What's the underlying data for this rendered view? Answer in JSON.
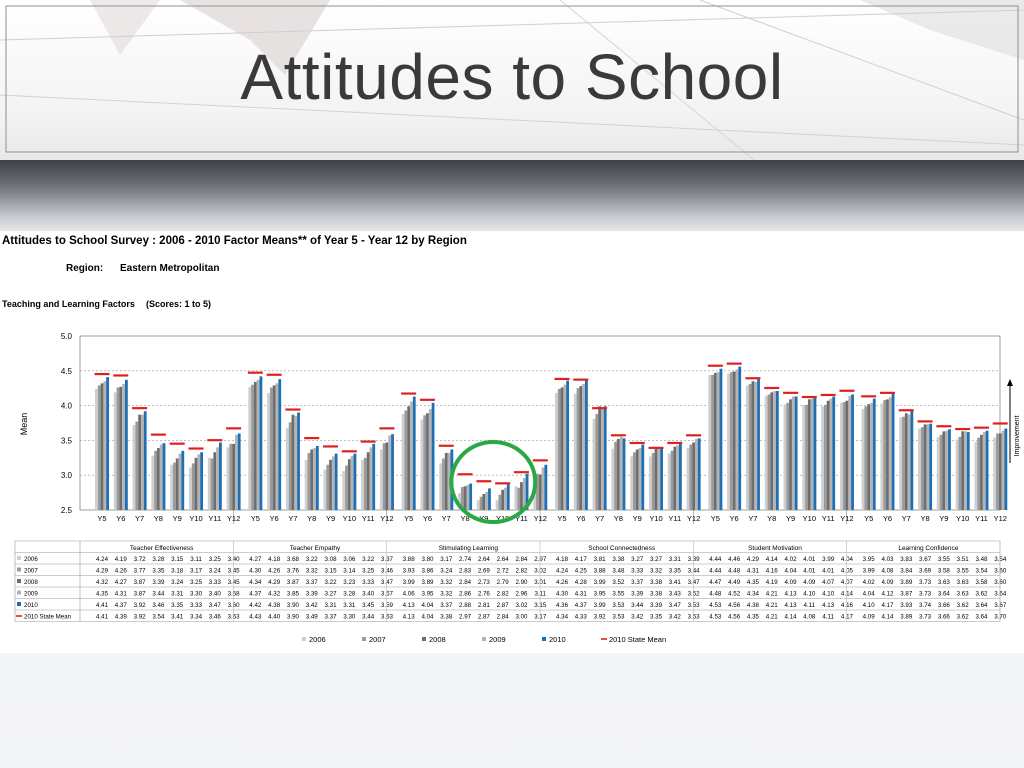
{
  "slide": {
    "title": "Attitudes to School"
  },
  "report": {
    "heading": "Attitudes to School Survey : 2006 - 2010 Factor Means** of Year 5 - Year 12 by Region",
    "region_label": "Region:",
    "region_value": "Eastern Metropolitan",
    "section_label": "Teaching and Learning Factors",
    "scores_label": "(Scores: 1 to 5)",
    "improvement_label": "Improvement"
  },
  "colors": {
    "2006": "#cfcfcf",
    "2007": "#9a9a9a",
    "2008": "#6e6e6e",
    "2009": "#b4b4b4",
    "2010": "#1f6fb5",
    "state": "#e02020",
    "highlight": "#2aa845"
  },
  "chart_data": {
    "type": "bar",
    "ylabel": "Mean",
    "ylim": [
      2.5,
      5.0
    ],
    "yticks": [
      2.5,
      3.0,
      3.5,
      4.0,
      4.5,
      5.0
    ],
    "grid": true,
    "legend_position": "bottom",
    "year_levels": [
      "Y5",
      "Y6",
      "Y7",
      "Y8",
      "Y9",
      "Y10",
      "Y11",
      "Y12"
    ],
    "factors": [
      {
        "name": "Teacher Effectiveness",
        "series": [
          {
            "name": "2006",
            "values": [
              "4.24",
              "4.19",
              "3.72",
              "3.28",
              "3.15",
              "3.11",
              "3.25",
              "3.40"
            ]
          },
          {
            "name": "2007",
            "values": [
              "4.29",
              "4.26",
              "3.77",
              "3.35",
              "3.18",
              "3.17",
              "3.24",
              "3.45"
            ]
          },
          {
            "name": "2008",
            "values": [
              "4.32",
              "4.27",
              "3.87",
              "3.39",
              "3.24",
              "3.25",
              "3.33",
              "3.45"
            ]
          },
          {
            "name": "2009",
            "values": [
              "4.35",
              "4.31",
              "3.87",
              "3.44",
              "3.31",
              "3.30",
              "3.40",
              "3.58"
            ]
          },
          {
            "name": "2010",
            "values": [
              "4.41",
              "4.37",
              "3.92",
              "3.46",
              "3.35",
              "3.33",
              "3.47",
              "3.60"
            ]
          },
          {
            "name": "2010 State Mean",
            "values": [
              "4.41",
              "4.39",
              "3.92",
              "3.54",
              "3.41",
              "3.34",
              "3.46",
              "3.63"
            ]
          }
        ]
      },
      {
        "name": "Teacher Empathy",
        "series": [
          {
            "name": "2006",
            "values": [
              "4.27",
              "4.18",
              "3.68",
              "3.22",
              "3.08",
              "3.06",
              "3.22",
              "3.37"
            ]
          },
          {
            "name": "2007",
            "values": [
              "4.30",
              "4.26",
              "3.76",
              "3.32",
              "3.15",
              "3.14",
              "3.25",
              "3.46"
            ]
          },
          {
            "name": "2008",
            "values": [
              "4.34",
              "4.29",
              "3.87",
              "3.37",
              "3.22",
              "3.23",
              "3.33",
              "3.47"
            ]
          },
          {
            "name": "2009",
            "values": [
              "4.37",
              "4.32",
              "3.85",
              "3.39",
              "3.27",
              "3.28",
              "3.40",
              "3.57"
            ]
          },
          {
            "name": "2010",
            "values": [
              "4.42",
              "4.38",
              "3.90",
              "3.42",
              "3.31",
              "3.31",
              "3.45",
              "3.59"
            ]
          },
          {
            "name": "2010 State Mean",
            "values": [
              "4.43",
              "4.40",
              "3.90",
              "3.49",
              "3.37",
              "3.30",
              "3.44",
              "3.63"
            ]
          }
        ]
      },
      {
        "name": "Stimulating Learning",
        "series": [
          {
            "name": "2006",
            "values": [
              "3.88",
              "3.80",
              "3.17",
              "2.74",
              "2.64",
              "2.64",
              "2.84",
              "2.97"
            ]
          },
          {
            "name": "2007",
            "values": [
              "3.93",
              "3.86",
              "3.24",
              "2.83",
              "2.69",
              "2.72",
              "2.82",
              "3.02"
            ]
          },
          {
            "name": "2008",
            "values": [
              "3.99",
              "3.89",
              "3.32",
              "2.84",
              "2.73",
              "2.79",
              "2.90",
              "3.01"
            ]
          },
          {
            "name": "2009",
            "values": [
              "4.06",
              "3.95",
              "3.32",
              "2.86",
              "2.76",
              "2.82",
              "2.96",
              "3.11"
            ]
          },
          {
            "name": "2010",
            "values": [
              "4.13",
              "4.04",
              "3.37",
              "2.88",
              "2.81",
              "2.87",
              "3.02",
              "3.15"
            ]
          },
          {
            "name": "2010 State Mean",
            "values": [
              "4.13",
              "4.04",
              "3.38",
              "2.97",
              "2.87",
              "2.84",
              "3.00",
              "3.17"
            ]
          }
        ]
      },
      {
        "name": "School Connectedness",
        "series": [
          {
            "name": "2006",
            "values": [
              "4.18",
              "4.17",
              "3.81",
              "3.38",
              "3.27",
              "3.27",
              "3.31",
              "3.39"
            ]
          },
          {
            "name": "2007",
            "values": [
              "4.24",
              "4.25",
              "3.88",
              "3.48",
              "3.33",
              "3.32",
              "3.35",
              "3.44"
            ]
          },
          {
            "name": "2008",
            "values": [
              "4.26",
              "4.28",
              "3.99",
              "3.52",
              "3.37",
              "3.38",
              "3.41",
              "3.47"
            ]
          },
          {
            "name": "2009",
            "values": [
              "4.30",
              "4.31",
              "3.95",
              "3.55",
              "3.39",
              "3.38",
              "3.43",
              "3.52"
            ]
          },
          {
            "name": "2010",
            "values": [
              "4.36",
              "4.37",
              "3.99",
              "3.53",
              "3.44",
              "3.39",
              "3.47",
              "3.53"
            ]
          },
          {
            "name": "2010 State Mean",
            "values": [
              "4.34",
              "4.33",
              "3.92",
              "3.53",
              "3.42",
              "3.35",
              "3.42",
              "3.53"
            ]
          }
        ]
      },
      {
        "name": "Student Motivation",
        "series": [
          {
            "name": "2006",
            "values": [
              "4.44",
              "4.46",
              "4.29",
              "4.14",
              "4.02",
              "4.01",
              "3.99",
              "4.04"
            ]
          },
          {
            "name": "2007",
            "values": [
              "4.44",
              "4.48",
              "4.31",
              "4.16",
              "4.04",
              "4.01",
              "4.01",
              "4.05"
            ]
          },
          {
            "name": "2008",
            "values": [
              "4.47",
              "4.49",
              "4.35",
              "4.19",
              "4.09",
              "4.09",
              "4.07",
              "4.07"
            ]
          },
          {
            "name": "2009",
            "values": [
              "4.48",
              "4.52",
              "4.34",
              "4.21",
              "4.13",
              "4.10",
              "4.10",
              "4.14"
            ]
          },
          {
            "name": "2010",
            "values": [
              "4.53",
              "4.56",
              "4.38",
              "4.21",
              "4.13",
              "4.11",
              "4.13",
              "4.16"
            ]
          },
          {
            "name": "2010 State Mean",
            "values": [
              "4.53",
              "4.56",
              "4.35",
              "4.21",
              "4.14",
              "4.08",
              "4.11",
              "4.17"
            ]
          }
        ]
      },
      {
        "name": "Learning Confidence",
        "series": [
          {
            "name": "2006",
            "values": [
              "3.95",
              "4.03",
              "3.83",
              "3.67",
              "3.55",
              "3.51",
              "3.48",
              "3.54"
            ]
          },
          {
            "name": "2007",
            "values": [
              "3.99",
              "4.08",
              "3.84",
              "3.69",
              "3.58",
              "3.55",
              "3.54",
              "3.60"
            ]
          },
          {
            "name": "2008",
            "values": [
              "4.02",
              "4.09",
              "3.89",
              "3.73",
              "3.63",
              "3.63",
              "3.58",
              "3.60"
            ]
          },
          {
            "name": "2009",
            "values": [
              "4.04",
              "4.12",
              "3.87",
              "3.73",
              "3.64",
              "3.63",
              "3.62",
              "3.64"
            ]
          },
          {
            "name": "2010",
            "values": [
              "4.10",
              "4.17",
              "3.93",
              "3.74",
              "3.66",
              "3.62",
              "3.64",
              "3.67"
            ]
          },
          {
            "name": "2010 State Mean",
            "values": [
              "4.09",
              "4.14",
              "3.89",
              "3.73",
              "3.66",
              "3.62",
              "3.64",
              "3.70"
            ]
          }
        ]
      }
    ],
    "legend": [
      "2006",
      "2007",
      "2008",
      "2009",
      "2010",
      "2010 State Mean"
    ],
    "highlight": {
      "factor": "Stimulating Learning",
      "shape": "circle"
    }
  }
}
